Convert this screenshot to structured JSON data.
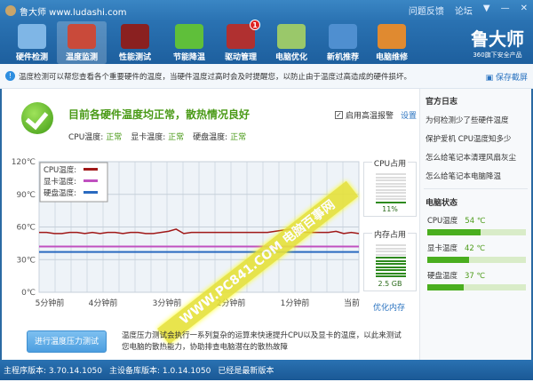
{
  "window": {
    "title": "鲁大师 www.ludashi.com",
    "links": [
      "问题反馈",
      "论坛"
    ]
  },
  "toolbar": {
    "items": [
      {
        "label": "硬件检测",
        "icon": "monitor-magnifier-icon",
        "color": "#7fb6e6"
      },
      {
        "label": "温度监测",
        "icon": "thermometer-icon",
        "color": "#c94a3a",
        "active": true
      },
      {
        "label": "性能测试",
        "icon": "speedometer-icon",
        "color": "#8a2020"
      },
      {
        "label": "节能降温",
        "icon": "clover-icon",
        "color": "#5fbf3a"
      },
      {
        "label": "驱动管理",
        "icon": "toolbox-icon",
        "color": "#b03030",
        "badge": "1"
      },
      {
        "label": "电脑优化",
        "icon": "monitor-wand-icon",
        "color": "#9ac86a"
      },
      {
        "label": "新机推荐",
        "icon": "monitor-medal-icon",
        "color": "#4f8fd0"
      },
      {
        "label": "电脑维修",
        "icon": "house-icon",
        "color": "#e08a30"
      }
    ],
    "brand": "鲁大师",
    "brand_sub": "360旗下安全产品"
  },
  "notice": {
    "text": "温度检测可以帮您查看各个重要硬件的温度，当硬件温度过高时会及时提醒您，以防止由于温度过高造成的硬件损坏。",
    "save": "保存截屏"
  },
  "status_panel": {
    "headline": "目前各硬件温度均正常，散热情况良好",
    "cpu_label": "CPU温度:",
    "cpu": "正常",
    "gpu_label": "显卡温度:",
    "gpu": "正常",
    "disk_label": "硬盘温度:",
    "disk": "正常",
    "alarm_label": "启用高温报警",
    "alarm_checked": true,
    "settings": "设置"
  },
  "chart_data": {
    "type": "line",
    "y_ticks": [
      "120℃",
      "90℃",
      "60℃",
      "30℃",
      "0℃"
    ],
    "ylim": [
      0,
      120
    ],
    "x_ticks": [
      "5分钟前",
      "4分钟前",
      "3分钟前",
      "2分钟前",
      "1分钟前",
      "当前"
    ],
    "legend": [
      "CPU温度:",
      "显卡温度:",
      "硬盘温度:"
    ],
    "series": [
      {
        "name": "CPU温度",
        "color": "#a01818",
        "values": [
          55,
          55,
          54,
          54,
          55,
          55,
          54,
          55,
          54,
          55,
          55,
          54,
          55,
          55,
          54,
          54,
          55,
          56,
          58,
          54,
          55,
          55,
          55,
          55,
          55,
          55,
          55,
          55,
          55,
          55,
          55,
          56,
          57,
          58,
          56,
          55,
          55,
          55,
          55,
          56,
          54,
          55,
          54
        ]
      },
      {
        "name": "显卡温度",
        "color": "#c050c0",
        "values": [
          42,
          42
        ]
      },
      {
        "name": "硬盘温度",
        "color": "#2a6ac0",
        "values": [
          37,
          37
        ]
      }
    ]
  },
  "gauges": {
    "cpu_label": "CPU占用",
    "cpu_value": "11%",
    "cpu_fraction": 0.11,
    "mem_label": "内存占用",
    "mem_value": "2.5 GB",
    "mem_fraction": 0.6,
    "optimize": "优化内存"
  },
  "stress": {
    "button": "进行温度压力测试",
    "desc": "温度压力测试会执行一系列复杂的运算来快速提升CPU以及显卡的温度，以此来测试您电脑的散热能力，协助排查电脑潜在的散热故障"
  },
  "sidebar": {
    "log_title": "官方日志",
    "logs": [
      "为何检测少了些硬件温度",
      "保护爱机 CPU温度知多少",
      "怎么给笔记本清理风扇灰尘",
      "怎么给笔记本电脑降温"
    ],
    "state_title": "电脑状态",
    "states": [
      {
        "label": "CPU温度",
        "value": "54 ℃",
        "pct": 54
      },
      {
        "label": "显卡温度",
        "value": "42 ℃",
        "pct": 42
      },
      {
        "label": "硬盘温度",
        "value": "37 ℃",
        "pct": 37
      }
    ]
  },
  "statusbar": {
    "main": "主程序版本: 3.70.14.1050",
    "db": "主设备库版本: 1.0.14.1050",
    "latest": "已经是最新版本"
  },
  "watermark": "WWW.PC841.COM 电脑百事网"
}
